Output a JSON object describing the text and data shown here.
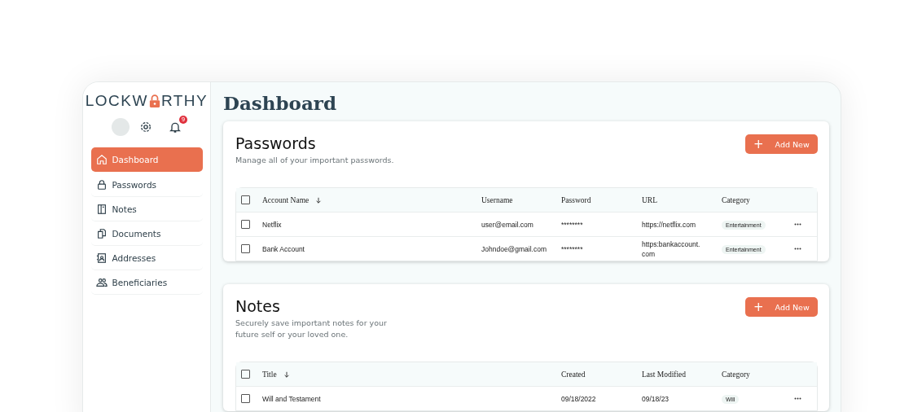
{
  "logo": {
    "before": "LOCKW",
    "after": "RTHY"
  },
  "notifications": {
    "count": "9"
  },
  "sidebar": {
    "items": [
      {
        "label": "Dashboard",
        "selected": true
      },
      {
        "label": "Passwords",
        "selected": false
      },
      {
        "label": "Notes",
        "selected": false
      },
      {
        "label": "Documents",
        "selected": false
      },
      {
        "label": "Addresses",
        "selected": false
      },
      {
        "label": "Beneficiaries",
        "selected": false
      }
    ]
  },
  "page_title": "Dashboard",
  "sections": [
    {
      "title": "Passwords",
      "subtitle": "Manage all of your important passwords.",
      "add_button": "+",
      "add_label": "Add New",
      "table": {
        "all_checked": false,
        "columns": [
          {
            "label": "Account Name",
            "sorted": true
          },
          {
            "label": "Username",
            "sorted": false
          },
          {
            "label": "Password",
            "sorted": false
          },
          {
            "label": "URL",
            "sorted": false
          },
          {
            "label": "Category",
            "sorted": false
          }
        ],
        "rows": [
          {
            "cells": [
              "Netflix",
              "user@email.com",
              "********",
              "https://netflix.com"
            ],
            "category": "Entertainment",
            "checked": false
          },
          {
            "cells": [
              "Bank Account",
              "Johndoe@gmail.com",
              "********",
              "https:bankaccount.\ncom"
            ],
            "category": "Entertainment",
            "checked": false
          }
        ]
      }
    },
    {
      "title": "Notes",
      "subtitle": "Securely save important notes for your\nfuture self or your loved one.",
      "add_button": "+",
      "add_label": "Add New",
      "table": {
        "all_checked": false,
        "columns": [
          {
            "label": "Title",
            "sorted": true
          },
          {
            "label": "Created",
            "sorted": false
          },
          {
            "label": "Last Modified",
            "sorted": false
          },
          {
            "label": "Category",
            "sorted": false
          }
        ],
        "rows": [
          {
            "cells": [
              "Will and Testament",
              "09/18/2022",
              "09/18/23"
            ],
            "category": "Will",
            "checked": false
          }
        ]
      }
    }
  ]
}
